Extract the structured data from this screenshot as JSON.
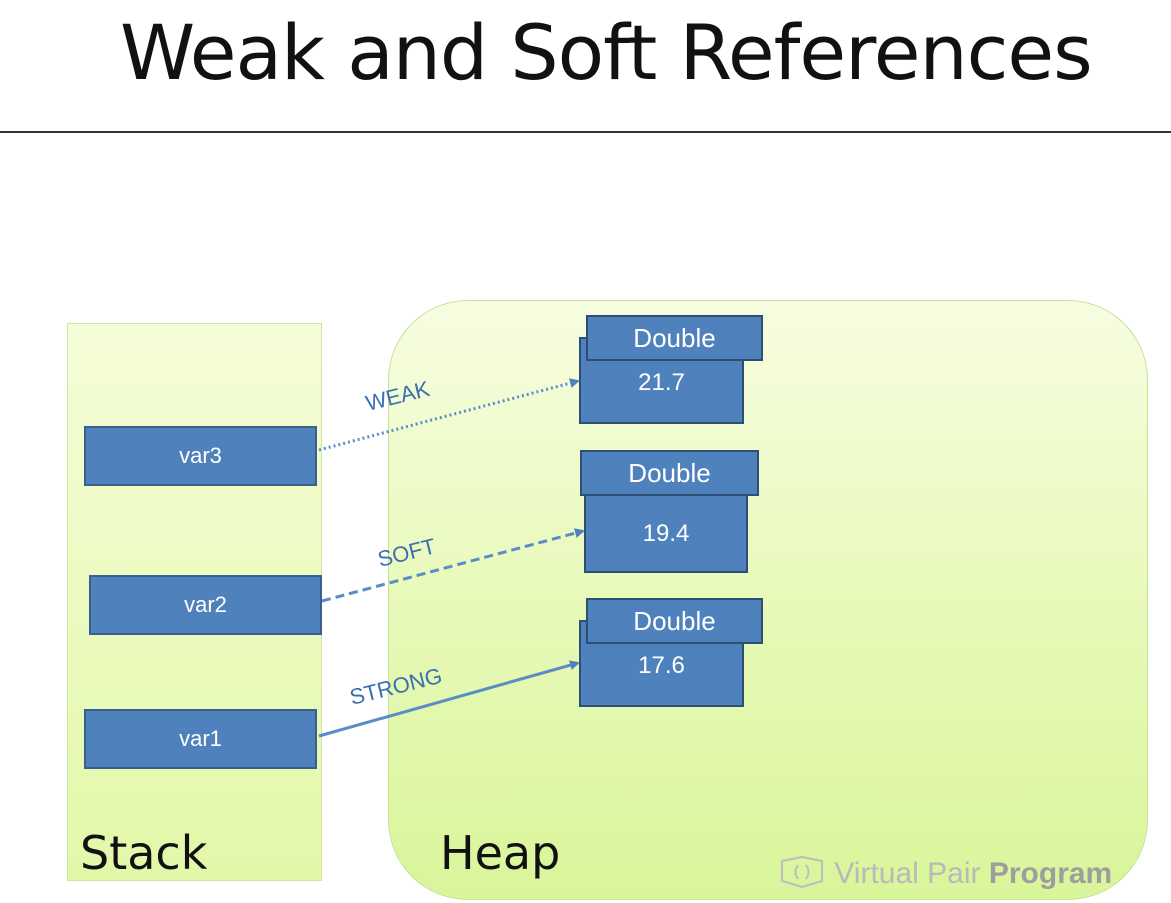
{
  "title": "Weak and Soft References",
  "stack": {
    "label": "Stack"
  },
  "heap": {
    "label": "Heap"
  },
  "variables": [
    "var3",
    "var2",
    "var1"
  ],
  "objects": [
    {
      "type": "Double",
      "value": "21.7"
    },
    {
      "type": "Double",
      "value": "19.4"
    },
    {
      "type": "Double",
      "value": "17.6"
    }
  ],
  "references": [
    {
      "from": "var3",
      "to": "21.7",
      "kind": "WEAK",
      "style": "dotted"
    },
    {
      "from": "var2",
      "to": "19.4",
      "kind": "SOFT",
      "style": "dashed"
    },
    {
      "from": "var1",
      "to": "17.6",
      "kind": "STRONG",
      "style": "solid"
    }
  ],
  "watermark": {
    "text": "Virtual Pair ",
    "bold": "Program"
  },
  "colors": {
    "box": "#4f81bd",
    "arrow": "#4f81bd",
    "label": "#3a6fb0",
    "panel": "#e6f9b6"
  }
}
